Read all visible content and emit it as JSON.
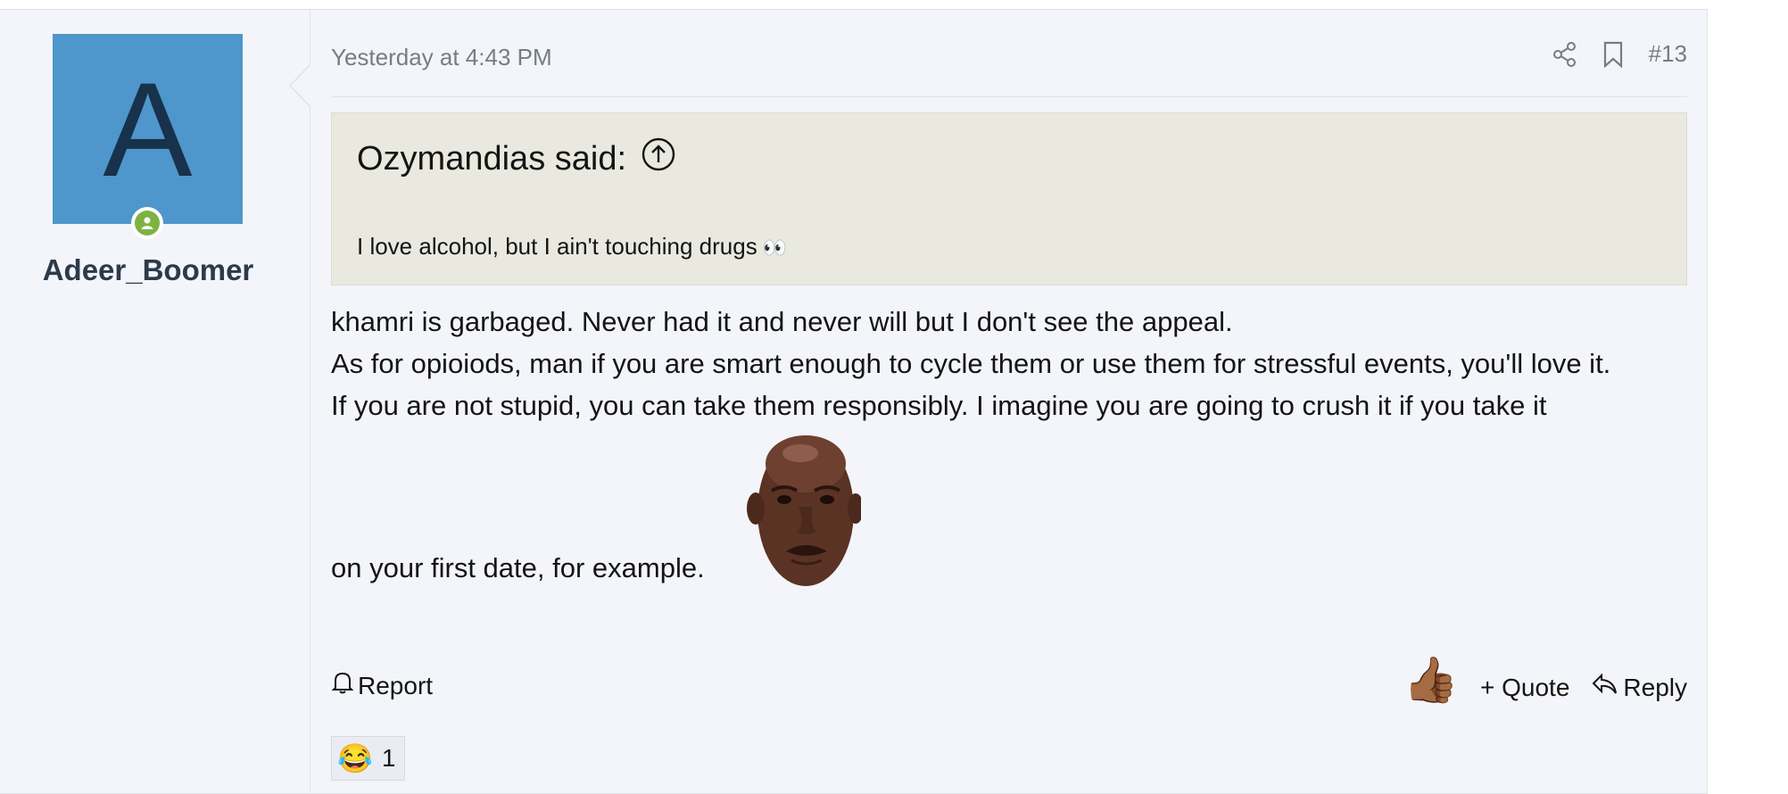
{
  "user": {
    "avatar_letter": "A",
    "username": "Adeer_Boomer"
  },
  "post": {
    "timestamp": "Yesterday at 4:43 PM",
    "post_number": "#13",
    "quote": {
      "author_said": "Ozymandias said:",
      "text": "I love alcohol, but I ain't touching drugs",
      "emoji": "👀"
    },
    "message": {
      "line1": "khamri is garbaged. Never had it and never will but I don't see the appeal.",
      "line2": "As for opioiods, man if you are smart enough to cycle them or use them for stressful events, you'll love it.",
      "line3": "If you are not stupid, you can take them responsibly. I imagine you are going to crush it if you take it",
      "line4": "on your first date, for example."
    },
    "actions": {
      "report": "Report",
      "like_emoji": "👍🏾",
      "quote": "+ Quote",
      "reply": "Reply"
    },
    "reactions": {
      "emoji": "😂",
      "count": "1"
    }
  },
  "icons": [
    "share-icon",
    "bookmark-icon",
    "arrow-up-circle-icon",
    "bell-icon",
    "reply-arrow-icon",
    "online-status-icon"
  ],
  "colors": {
    "avatar_bg": "#4e96cb",
    "avatar_letter": "#17324a",
    "quote_bg": "#e9e9df",
    "online_green": "#7cb342",
    "post_bg": "#f3f5fa",
    "meta_gray": "#747d87"
  }
}
